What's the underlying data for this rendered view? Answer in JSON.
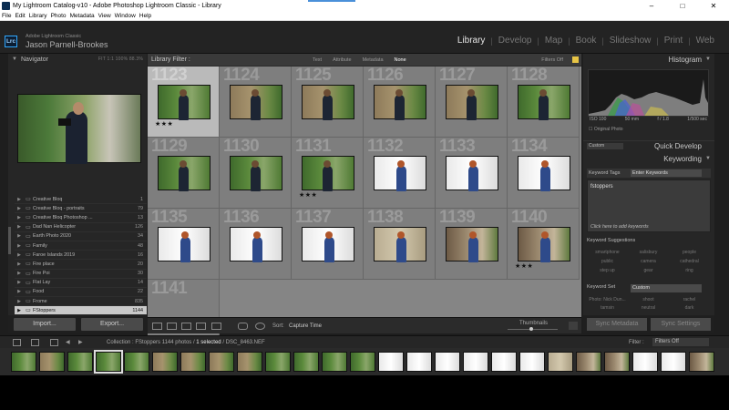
{
  "window": {
    "title": "My Lightroom Catalog-v10 - Adobe Photoshop Lightroom Classic - Library",
    "controls": [
      "–",
      "□",
      "✕"
    ]
  },
  "menu": [
    "File",
    "Edit",
    "Library",
    "Photo",
    "Metadata",
    "View",
    "Window",
    "Help"
  ],
  "identity": {
    "logo": "Lrc",
    "product": "Adobe Lightroom Classic",
    "user": "Jason Parnell-Brookes"
  },
  "modules": {
    "items": [
      "Library",
      "Develop",
      "Map",
      "Book",
      "Slideshow",
      "Print",
      "Web"
    ],
    "active": "Library"
  },
  "navigator": {
    "title": "Navigator",
    "options": "FIT   1:1   100%   88.3%"
  },
  "folders": [
    {
      "name": "Creative Bloq",
      "count": "1"
    },
    {
      "name": "Creative Bloq - portraits",
      "count": "79"
    },
    {
      "name": "Creative Bloq Photoshop ...",
      "count": "13"
    },
    {
      "name": "Dad Nan Helicopter",
      "count": "126"
    },
    {
      "name": "Earth Photo 2020",
      "count": "34"
    },
    {
      "name": "Family",
      "count": "48"
    },
    {
      "name": "Faroe Islands 2019",
      "count": "16"
    },
    {
      "name": "Fire place",
      "count": "20"
    },
    {
      "name": "Fire Poi",
      "count": "30"
    },
    {
      "name": "Flat Lay",
      "count": "14"
    },
    {
      "name": "Food",
      "count": "22"
    },
    {
      "name": "Frome",
      "count": "835"
    },
    {
      "name": "FStoppers",
      "count": "1144"
    }
  ],
  "leftButtons": {
    "import": "Import...",
    "export": "Export..."
  },
  "libraryFilter": {
    "title": "Library Filter :",
    "options": [
      "Text",
      "Attribute",
      "Metadata",
      "None"
    ],
    "active": "None",
    "status": "Filters Off"
  },
  "grid": {
    "cells": [
      {
        "idx": "1123",
        "stars": "★★★",
        "selected": true,
        "scene": "garden"
      },
      {
        "idx": "1124",
        "stars": "",
        "selected": false,
        "scene": "wall"
      },
      {
        "idx": "1125",
        "stars": "",
        "selected": false,
        "scene": "wall"
      },
      {
        "idx": "1126",
        "stars": "",
        "selected": false,
        "scene": "wall"
      },
      {
        "idx": "1127",
        "stars": "",
        "selected": false,
        "scene": "wall"
      },
      {
        "idx": "1128",
        "stars": "",
        "selected": false,
        "scene": "garden"
      },
      {
        "idx": "1129",
        "stars": "",
        "selected": false,
        "scene": "garden"
      },
      {
        "idx": "1130",
        "stars": "",
        "selected": false,
        "scene": "garden"
      },
      {
        "idx": "1131",
        "stars": "★★★",
        "selected": false,
        "scene": "garden"
      },
      {
        "idx": "1132",
        "stars": "",
        "selected": false,
        "scene": "white"
      },
      {
        "idx": "1133",
        "stars": "",
        "selected": false,
        "scene": "white"
      },
      {
        "idx": "1134",
        "stars": "",
        "selected": false,
        "scene": "white"
      },
      {
        "idx": "1135",
        "stars": "",
        "selected": false,
        "scene": "white"
      },
      {
        "idx": "1136",
        "stars": "",
        "selected": false,
        "scene": "white"
      },
      {
        "idx": "1137",
        "stars": "",
        "selected": false,
        "scene": "white"
      },
      {
        "idx": "1138",
        "stars": "",
        "selected": false,
        "scene": "stone"
      },
      {
        "idx": "1139",
        "stars": "",
        "selected": false,
        "scene": "house"
      },
      {
        "idx": "1140",
        "stars": "★★★",
        "selected": false,
        "scene": "house"
      },
      {
        "idx": "1141",
        "stars": "",
        "selected": false,
        "scene": "none"
      }
    ]
  },
  "toolbar": {
    "sort_label": "Sort:",
    "sort_value": "Capture Time",
    "thumbs": "Thumbnails"
  },
  "histogram": {
    "title": "Histogram",
    "iso": "ISO 100",
    "focal": "50 mm",
    "aperture": "f / 1.8",
    "shutter": "1/500 sec",
    "original": "Original Photo"
  },
  "quickDevelop": {
    "title": "Quick Develop",
    "preset": "Custom"
  },
  "keywording": {
    "title": "Keywording",
    "tags_label": "Keyword Tags",
    "tags_mode": "Enter Keywords",
    "value": "fstoppers",
    "hint": "Click here to add keywords",
    "suggestions_title": "Keyword Suggestions",
    "suggestions": [
      "smartphone",
      "salisbury",
      "people",
      "public",
      "camera",
      "cathedral",
      "step up",
      "gear",
      "ring"
    ],
    "set_label": "Keyword Set",
    "set_value": "Custom",
    "set_items": [
      "Photo: Nick Dun...",
      "shoot",
      "rachel",
      "tamsin",
      "neutral",
      "dark"
    ]
  },
  "rightButtons": {
    "sync_metadata": "Sync Metadata",
    "sync_settings": "Sync Settings"
  },
  "filmstrip": {
    "collection_label": "Collection : FStoppers",
    "count_label": "1144 photos /",
    "selected_label": "1 selected",
    "file_label": "/ DSC_8463.NEF",
    "filter_label": "Filter :",
    "filter_value": "Filters Off"
  },
  "colors": {
    "accent": "#31a8ff",
    "panel": "#262626",
    "grid_bg": "#858585",
    "selected_cell": "#bababa"
  }
}
